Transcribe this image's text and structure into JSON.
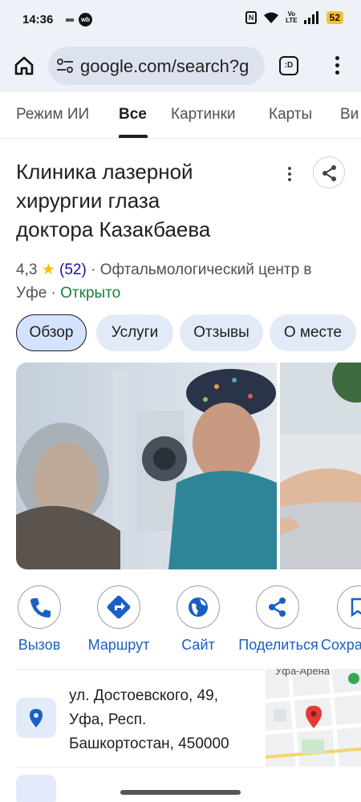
{
  "status_bar": {
    "time": "14:36",
    "app_badge": "wb",
    "nfc": "N",
    "volte_top": "Vo",
    "volte_bottom": "LTE",
    "battery": "52"
  },
  "browser": {
    "url": "google.com/search?g",
    "tabs_label": ":D"
  },
  "search_tabs": [
    {
      "label": "Режим ИИ",
      "active": false
    },
    {
      "label": "Все",
      "active": true
    },
    {
      "label": "Картинки",
      "active": false
    },
    {
      "label": "Карты",
      "active": false
    },
    {
      "label": "Ви",
      "active": false
    }
  ],
  "place": {
    "title_lines": [
      "Клиника лазерной",
      "хирургии глаза",
      "доктора Казакбаева"
    ],
    "rating": "4,3",
    "star": "★",
    "reviews": "(52)",
    "category": "· Офтальмологический центр в",
    "city": "Уфе ·",
    "status": "Открыто"
  },
  "chips": [
    {
      "label": "Обзор",
      "selected": true
    },
    {
      "label": "Услуги",
      "selected": false
    },
    {
      "label": "Отзывы",
      "selected": false
    },
    {
      "label": "О месте",
      "selected": false
    }
  ],
  "actions": [
    {
      "label": "Вызов",
      "icon": "phone-icon"
    },
    {
      "label": "Маршрут",
      "icon": "directions-icon"
    },
    {
      "label": "Сайт",
      "icon": "globe-icon"
    },
    {
      "label": "Поделиться",
      "icon": "share-icon"
    },
    {
      "label": "Сохранить",
      "icon": "bookmark-icon"
    }
  ],
  "address": {
    "lines": [
      "ул. Достоевского, 49,",
      "Уфа, Респ.",
      "Башкортостан, 450000"
    ]
  },
  "map_label": "Уфа-Арена",
  "colors": {
    "accent": "#1a5fc4",
    "chip_bg": "#e3eaf7",
    "open": "#188038",
    "star": "#fbbc04"
  }
}
